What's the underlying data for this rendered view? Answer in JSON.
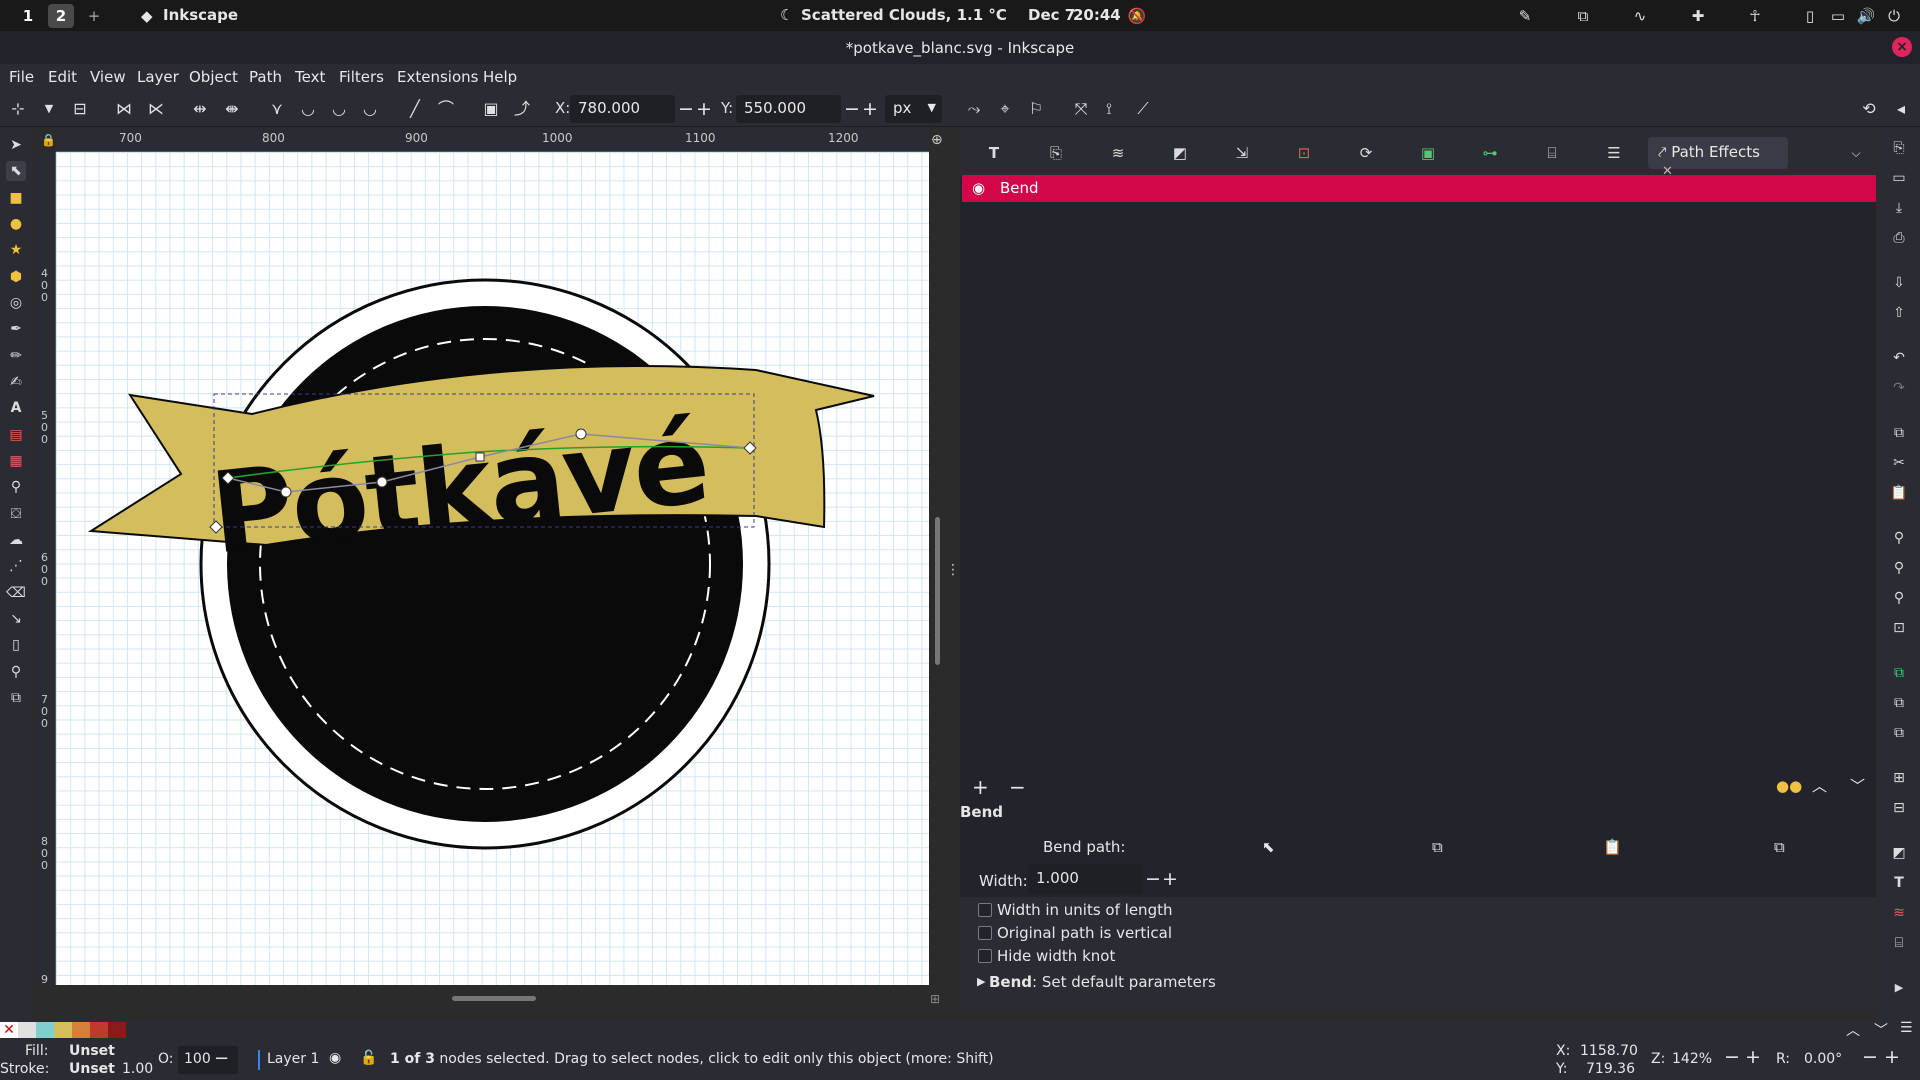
{
  "system_bar": {
    "workspace_1": "1",
    "workspace_2": "2",
    "add_workspace": "+",
    "app_name": "Inkscape",
    "weather": "Scattered Clouds, 1.1 °C",
    "date": "Dec 7",
    "time": "20:44"
  },
  "window": {
    "title": "*potkave_blanc.svg - Inkscape"
  },
  "menu": [
    "File",
    "Edit",
    "View",
    "Layer",
    "Object",
    "Path",
    "Text",
    "Filters",
    "Extensions",
    "Help"
  ],
  "toolbar": {
    "x_label": "X:",
    "x_value": "780.000",
    "y_label": "Y:",
    "y_value": "550.000",
    "unit": "px"
  },
  "ruler": {
    "h_ticks": [
      "700",
      "800",
      "900",
      "1000",
      "1100",
      "1200"
    ],
    "v_ticks": [
      "4\n0\n0",
      "5\n0\n0",
      "6\n0\n0",
      "7\n0\n0",
      "8\n0\n0",
      "9"
    ]
  },
  "canvas": {
    "logo_text": "Pótkávé",
    "colors": {
      "banner": "#d4bd5c",
      "disc": "#0a0a0a",
      "grid": "#cfe7f2"
    }
  },
  "dock": {
    "active_tab": "Path Effects",
    "effect_row": "Bend",
    "section_title": "Bend",
    "bend_path_label": "Bend path:",
    "width_label": "Width:",
    "width_value": "1.000",
    "opt_width_units": "Width in units of length",
    "opt_vertical": "Original path is vertical",
    "opt_hide_knot": "Hide width knot",
    "defaults_bold": "Bend",
    "defaults_rest": ": Set default parameters",
    "accent": "#d4064a"
  },
  "statusbar": {
    "fill_label": "Fill:",
    "fill_value": "Unset",
    "stroke_label": "Stroke:",
    "stroke_value": "Unset",
    "stroke_width": "1.00",
    "opacity_label": "O:",
    "opacity_value": "100",
    "layer": "Layer 1",
    "message_bold": "1 of 3",
    "message": " nodes selected. Drag to select nodes, click to edit only this object (more: Shift)",
    "x_label": "X:",
    "x_value": "1158.70",
    "y_label": "Y:",
    "y_value": "719.36",
    "zoom_label": "Z:",
    "zoom_value": "142%",
    "rotate_label": "R:",
    "rotate_value": "0.00°"
  },
  "palette": [
    "#e0e0e0",
    "#7fcfcf",
    "#d4bd5c",
    "#d4803a",
    "#c0392b",
    "#8b1a1a",
    "#3a1010"
  ]
}
